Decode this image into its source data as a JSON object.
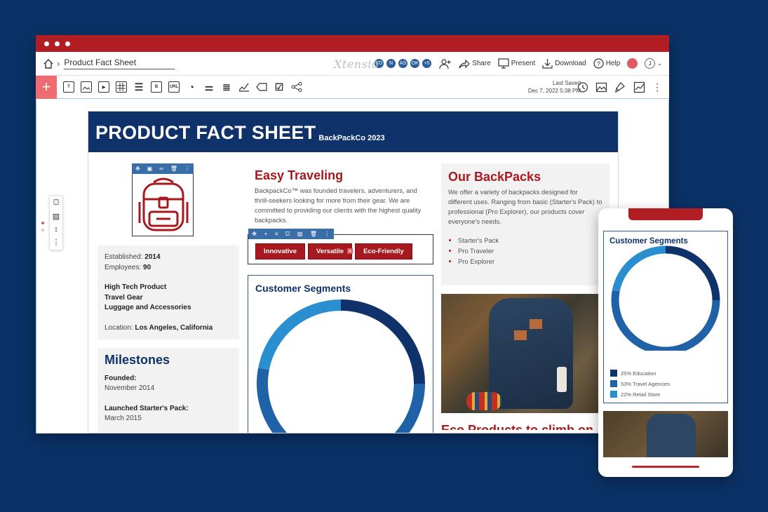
{
  "toolbar": {
    "doc_title": "Product Fact Sheet",
    "brand": "Xtensio",
    "avatars": [
      "FD",
      "N",
      "AS",
      "OK",
      "+5"
    ],
    "share_label": "Share",
    "present_label": "Present",
    "download_label": "Download",
    "help_label": "Help",
    "user_initial": "J"
  },
  "insertbar": {
    "last_saved_label": "Last Saved",
    "last_saved_time": "Dec 7, 2022 5:38 PM",
    "b_label": "B",
    "url_label": "URL"
  },
  "page": {
    "title": "PRODUCT FACT SHEET",
    "subtitle": "BackPackCo 2023",
    "info": {
      "established_label": "Established:",
      "established_value": "2014",
      "employees_label": "Employees:",
      "employees_value": "90",
      "categories": [
        "High Tech Product",
        "Travel Gear",
        "Luggage and Accessories"
      ],
      "location_label": "Location:",
      "location_value": "Los Angeles, California"
    },
    "milestones": {
      "title": "Milestones",
      "items": [
        {
          "label": "Founded:",
          "date": "November 2014"
        },
        {
          "label": "Launched Starter's Pack:",
          "date": "March 2015"
        }
      ]
    },
    "easy": {
      "title": "Easy Traveling",
      "body": "BackpackCo™ was founded travelers, adventurers, and thrill-seekers looking for more from their gear. We are committed to providing our clients with the highest quality backpacks."
    },
    "tags": [
      "Innovative",
      "Versatile",
      "Eco-Friendly"
    ],
    "segments_title": "Customer Segments",
    "backpacks": {
      "title": "Our BackPacks",
      "body": "We offer a variety of backpacks designed for different uses. Ranging from basic (Starter's Pack) to professional (Pro Explorer), our products cover everyone's needs.",
      "items": [
        "Starter's Pack",
        "Pro Traveler",
        "Pro Explorer"
      ]
    },
    "next_heading": "Eco Products to climb on"
  },
  "phone": {
    "segments_title": "Customer Segments"
  },
  "chart_data": {
    "type": "pie",
    "title": "Customer Segments",
    "categories": [
      "Education",
      "Travel Agencies",
      "Retail Store"
    ],
    "values": [
      25,
      53,
      22
    ],
    "labels": [
      "25%",
      "53%",
      "22%"
    ],
    "colors": [
      "#0f326a",
      "#1f62a8",
      "#2a8fd0"
    ],
    "donut": true
  }
}
